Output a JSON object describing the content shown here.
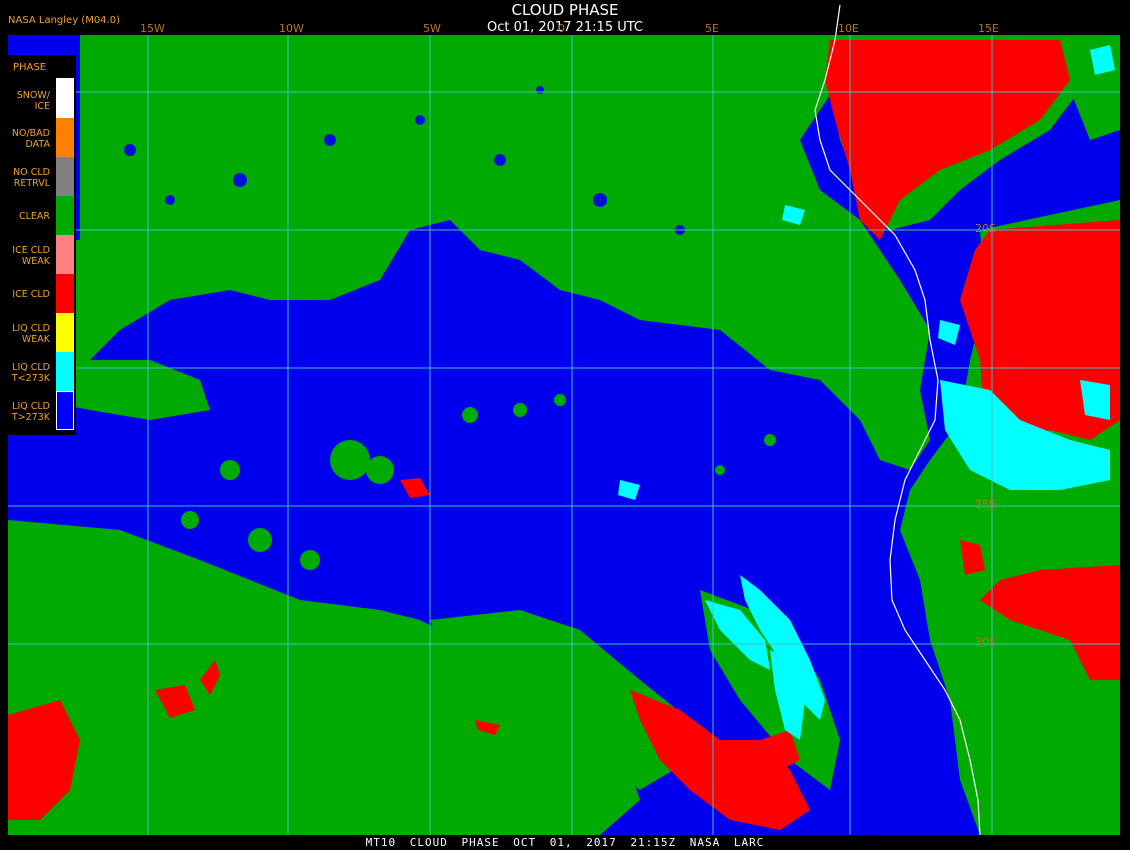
{
  "header": {
    "title": "CLOUD PHASE",
    "subtitle": "Oct 01, 2017 21:15 UTC",
    "source": "NASA Langley (M04.0)"
  },
  "longitude_labels": [
    "15W",
    "10W",
    "5W",
    "0",
    "5E",
    "10E",
    "15E"
  ],
  "latitude_labels": [
    "20S",
    "25S",
    "30S"
  ],
  "legend": {
    "title": "PHASE",
    "items": [
      {
        "line1": "SNOW/",
        "line2": "ICE",
        "color": "#ffffff"
      },
      {
        "line1": "NO/BAD",
        "line2": "DATA",
        "color": "#ff8000"
      },
      {
        "line1": "NO CLD",
        "line2": "RETRVL",
        "color": "#808080"
      },
      {
        "line1": "CLEAR",
        "line2": "",
        "color": "#00aa00"
      },
      {
        "line1": "ICE CLD",
        "line2": "WEAK",
        "color": "#ff8080"
      },
      {
        "line1": "ICE CLD",
        "line2": "",
        "color": "#ff0000"
      },
      {
        "line1": "LIQ CLD",
        "line2": "WEAK",
        "color": "#ffff00"
      },
      {
        "line1": "LIQ CLD",
        "line2": "T<273K",
        "color": "#00ffff"
      },
      {
        "line1": "LIQ CLD",
        "line2": "T>273K",
        "color": "#0000ff"
      }
    ]
  },
  "colors": {
    "liquid_warm": "#0000ee",
    "clear": "#00aa00",
    "ice": "#ff0000",
    "liquid_cold": "#00ffff",
    "grid": "#40c0c0",
    "coast": "#ffffff"
  },
  "footer": "MT10  CLOUD PHASE  OCT 01, 2017 21:15Z  NASA LARC"
}
